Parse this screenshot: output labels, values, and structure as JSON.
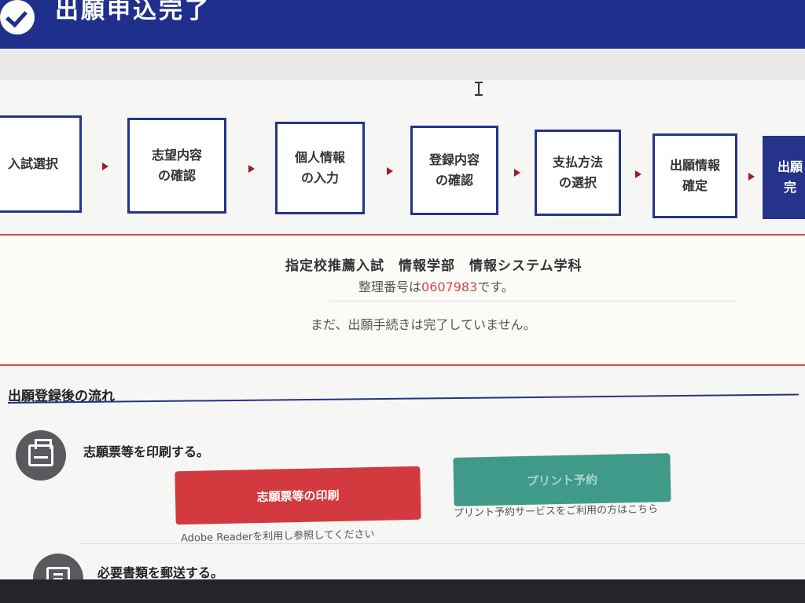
{
  "header": {
    "title": "出願申込完了",
    "icon": "check-circle-icon"
  },
  "steps": [
    {
      "label": "入試選択",
      "active": false
    },
    {
      "label": "志望内容\nの確認",
      "active": false
    },
    {
      "label": "個人情報\nの入力",
      "active": false
    },
    {
      "label": "登録内容\nの確認",
      "active": false
    },
    {
      "label": "支払方法\nの選択",
      "active": false
    },
    {
      "label": "出願情報\n確定",
      "active": false
    },
    {
      "label": "出願\n完",
      "active": true
    }
  ],
  "notice": {
    "title": "指定校推薦入試　情報学部　情報システム学科",
    "number_prefix": "整理番号は",
    "number": "0607983",
    "number_suffix": "です。",
    "status": "まだ、出願手続きは完了していません。"
  },
  "flow": {
    "heading": "出願登録後の流れ",
    "print_row": {
      "icon": "printer-icon",
      "label": "志願票等を印刷する。",
      "print_button": "志願票等の印刷",
      "print_note": "Adobe Readerを利用し参照してください",
      "reserve_button": "プリント予約",
      "reserve_note": "プリント予約サービスをご利用の方はこちら"
    },
    "mail_row": {
      "icon": "mail-document-icon",
      "label": "必要書類を郵送する。"
    }
  },
  "colors": {
    "primary": "#1f2f8c",
    "alert_border": "#d84b4b",
    "number_highlight": "#d04646",
    "print_button": "#d23a3f",
    "reserve_button": "#3f9a8a"
  }
}
